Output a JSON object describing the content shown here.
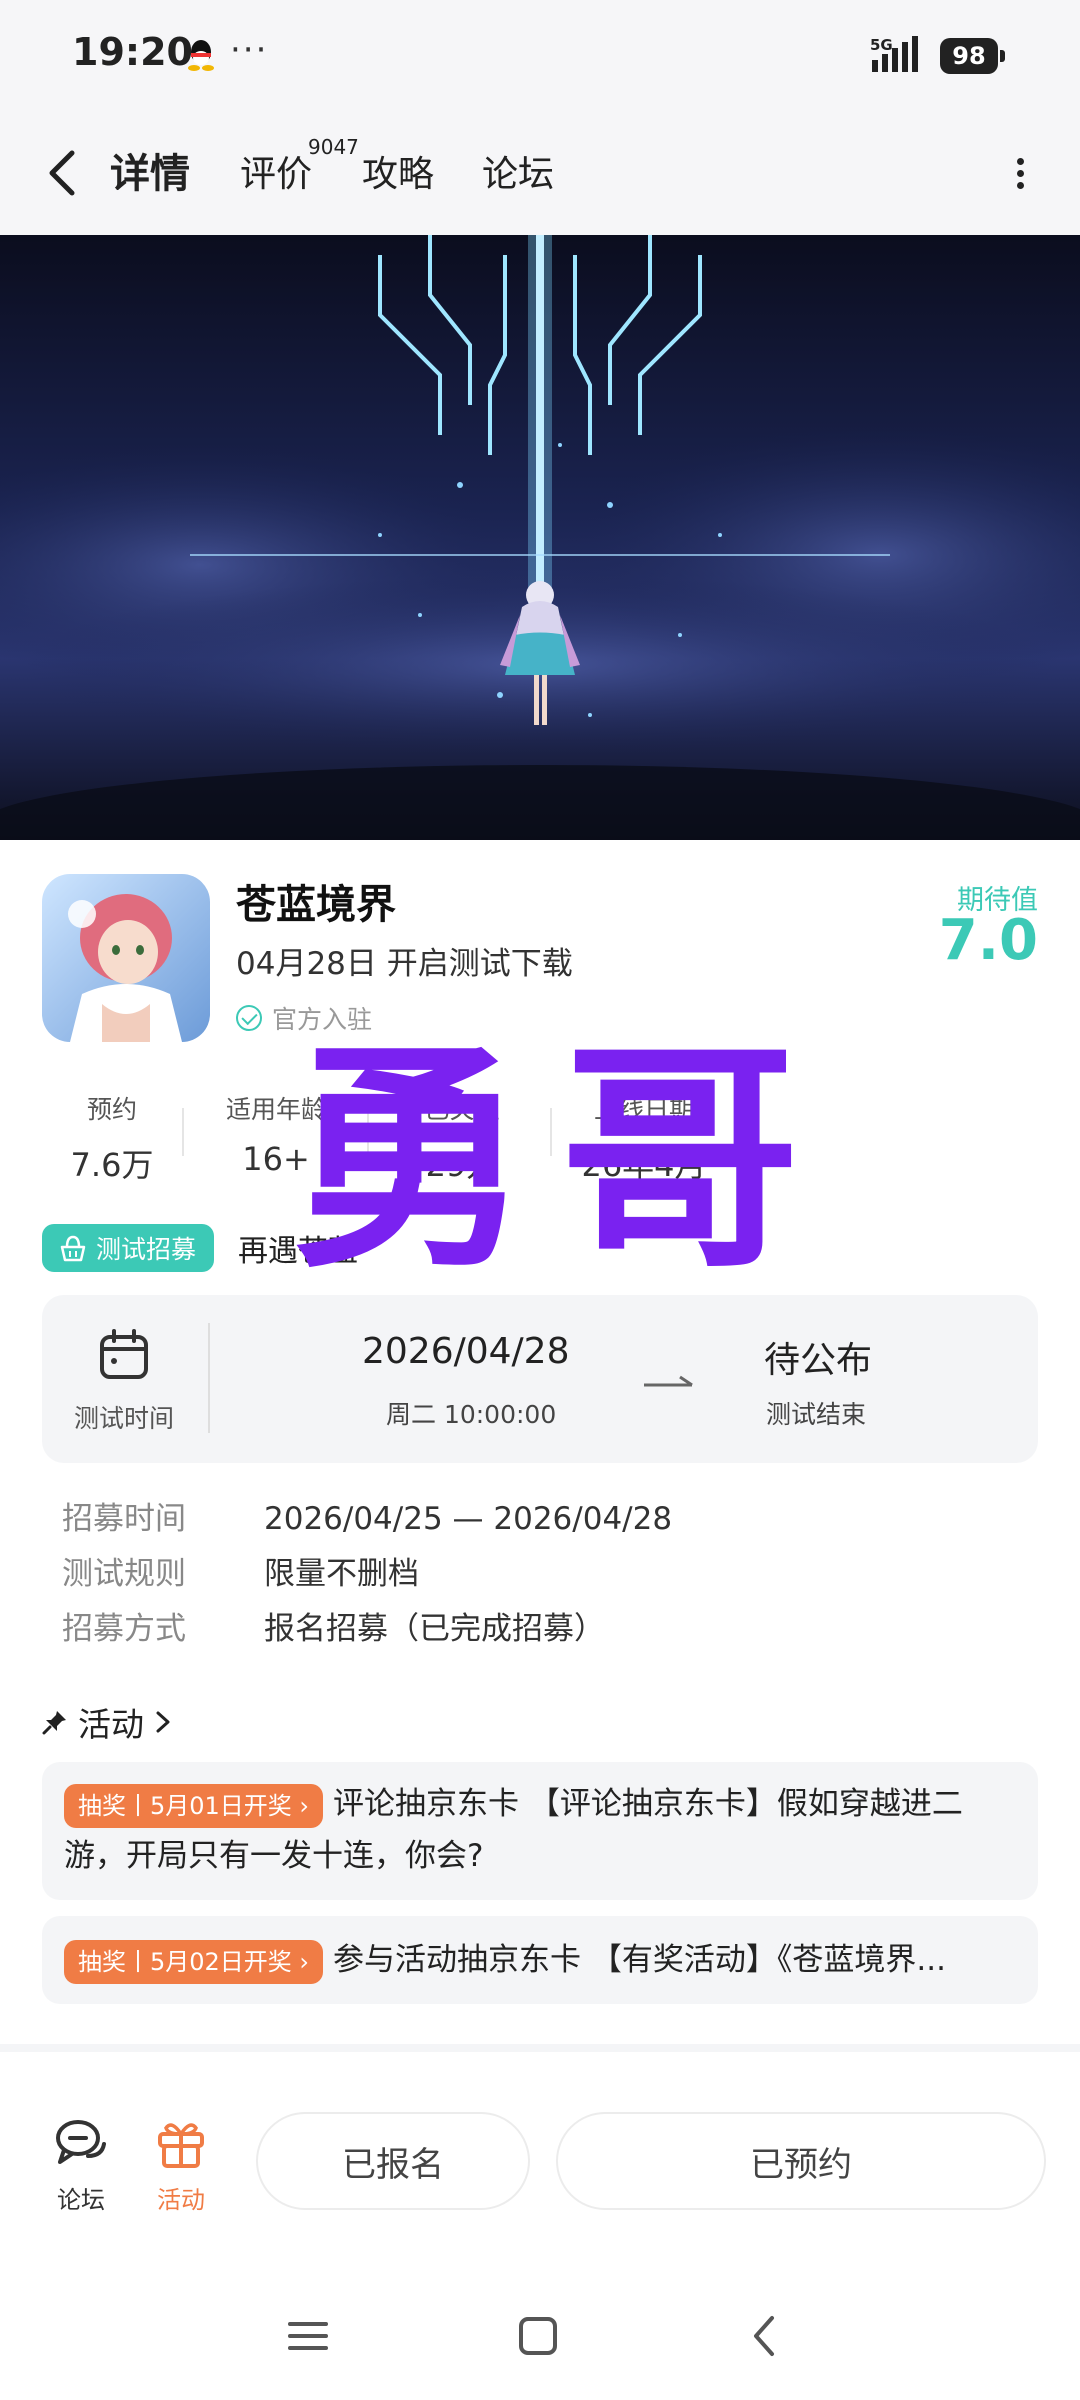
{
  "status_bar": {
    "time": "19:20",
    "dots": "···",
    "network": "5G",
    "battery": "98"
  },
  "nav": {
    "tabs": [
      {
        "label": "详情"
      },
      {
        "label": "评价",
        "badge": "9047"
      },
      {
        "label": "攻略"
      },
      {
        "label": "论坛"
      }
    ]
  },
  "game": {
    "title": "苍蓝境界",
    "subtitle": "04月28日 开启测试下载",
    "official": "官方入驻",
    "expect_label": "期待值",
    "expect_value": "7.0"
  },
  "stats": [
    {
      "key": "预约",
      "value": "7.6万"
    },
    {
      "key": "适用年龄",
      "value": "16+"
    },
    {
      "key": "已关注",
      "value": "29万"
    },
    {
      "key": "上线日期",
      "value": "26年4月"
    }
  ],
  "recruit": {
    "tag": "测试招募",
    "text": "再遇苍蓝"
  },
  "test_time": {
    "label": "测试时间",
    "start_date": "2026/04/28",
    "start_sub": "周二  10:00:00",
    "end_value": "待公布",
    "end_sub": "测试结束"
  },
  "info": [
    {
      "key": "招募时间",
      "value": "2026/04/25 — 2026/04/28"
    },
    {
      "key": "测试规则",
      "value": "限量不删档"
    },
    {
      "key": "招募方式",
      "value": "报名招募（已完成招募）"
    }
  ],
  "activity": {
    "heading": "活动",
    "items": [
      {
        "pill": "抽奖丨5月01日开奖 ›",
        "text": "评论抽京东卡 【评论抽京东卡】假如穿越进二游，开局只有一发十连，你会?"
      },
      {
        "pill": "抽奖丨5月02日开奖 ›",
        "text": "参与活动抽京东卡 【有奖活动】《苍蓝境界..."
      }
    ]
  },
  "bottom_bar": {
    "forum": "论坛",
    "activity": "活动",
    "registered": "已报名",
    "reserved": "已预约"
  },
  "watermark": "勇哥",
  "colors": {
    "accent": "#3cc9b6",
    "orange": "#f07c45",
    "watermark": "#7a22f0"
  }
}
